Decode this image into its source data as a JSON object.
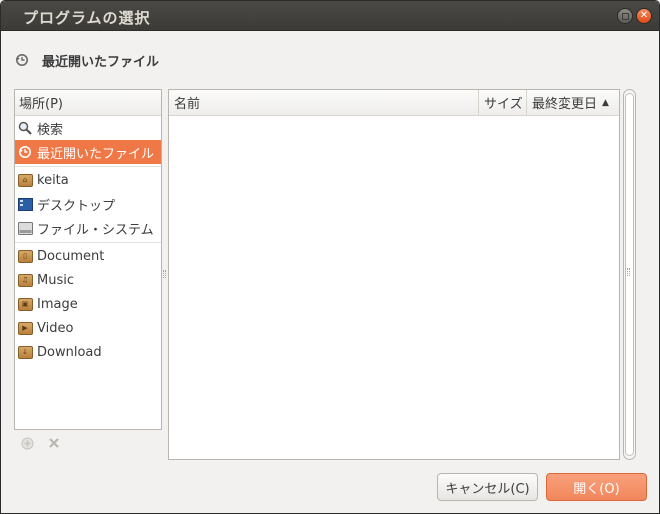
{
  "window": {
    "title": "プログラムの選択"
  },
  "location": {
    "label": "最近開いたファイル",
    "icon": "recent-clock-icon"
  },
  "places": {
    "header": "場所(P)",
    "items": [
      {
        "label": "検索",
        "icon": "search-icon"
      },
      {
        "label": "最近開いたファイル",
        "icon": "recent-clock-icon",
        "selected": true
      },
      {
        "label": "keita",
        "icon": "home-folder-icon"
      },
      {
        "label": "デスクトップ",
        "icon": "desktop-icon"
      },
      {
        "label": "ファイル・システム",
        "icon": "drive-icon"
      },
      {
        "label": "Document",
        "icon": "document-folder-icon"
      },
      {
        "label": "Music",
        "icon": "music-folder-icon"
      },
      {
        "label": "Image",
        "icon": "image-folder-icon"
      },
      {
        "label": "Video",
        "icon": "video-folder-icon"
      },
      {
        "label": "Download",
        "icon": "download-folder-icon"
      }
    ]
  },
  "files": {
    "columns": {
      "name": "名前",
      "size": "サイズ",
      "modified": "最終変更日"
    },
    "rows": []
  },
  "buttons": {
    "cancel": "キャンセル(C)",
    "open": "開く(O)"
  },
  "colors": {
    "accent": "#f07746",
    "titlebar": "#3c3b37"
  }
}
